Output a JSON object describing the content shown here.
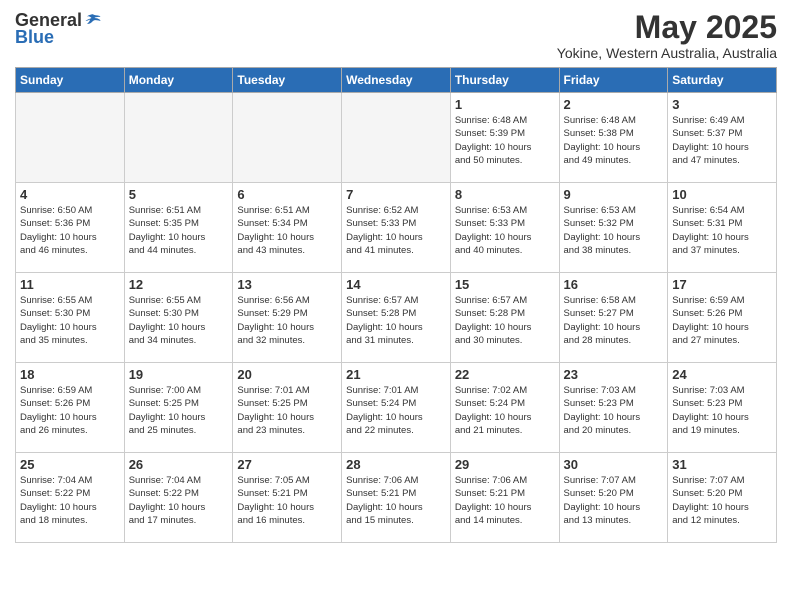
{
  "header": {
    "logo_general": "General",
    "logo_blue": "Blue",
    "month_title": "May 2025",
    "location": "Yokine, Western Australia, Australia"
  },
  "weekdays": [
    "Sunday",
    "Monday",
    "Tuesday",
    "Wednesday",
    "Thursday",
    "Friday",
    "Saturday"
  ],
  "weeks": [
    [
      {
        "day": "",
        "info": ""
      },
      {
        "day": "",
        "info": ""
      },
      {
        "day": "",
        "info": ""
      },
      {
        "day": "",
        "info": ""
      },
      {
        "day": "1",
        "info": "Sunrise: 6:48 AM\nSunset: 5:39 PM\nDaylight: 10 hours\nand 50 minutes."
      },
      {
        "day": "2",
        "info": "Sunrise: 6:48 AM\nSunset: 5:38 PM\nDaylight: 10 hours\nand 49 minutes."
      },
      {
        "day": "3",
        "info": "Sunrise: 6:49 AM\nSunset: 5:37 PM\nDaylight: 10 hours\nand 47 minutes."
      }
    ],
    [
      {
        "day": "4",
        "info": "Sunrise: 6:50 AM\nSunset: 5:36 PM\nDaylight: 10 hours\nand 46 minutes."
      },
      {
        "day": "5",
        "info": "Sunrise: 6:51 AM\nSunset: 5:35 PM\nDaylight: 10 hours\nand 44 minutes."
      },
      {
        "day": "6",
        "info": "Sunrise: 6:51 AM\nSunset: 5:34 PM\nDaylight: 10 hours\nand 43 minutes."
      },
      {
        "day": "7",
        "info": "Sunrise: 6:52 AM\nSunset: 5:33 PM\nDaylight: 10 hours\nand 41 minutes."
      },
      {
        "day": "8",
        "info": "Sunrise: 6:53 AM\nSunset: 5:33 PM\nDaylight: 10 hours\nand 40 minutes."
      },
      {
        "day": "9",
        "info": "Sunrise: 6:53 AM\nSunset: 5:32 PM\nDaylight: 10 hours\nand 38 minutes."
      },
      {
        "day": "10",
        "info": "Sunrise: 6:54 AM\nSunset: 5:31 PM\nDaylight: 10 hours\nand 37 minutes."
      }
    ],
    [
      {
        "day": "11",
        "info": "Sunrise: 6:55 AM\nSunset: 5:30 PM\nDaylight: 10 hours\nand 35 minutes."
      },
      {
        "day": "12",
        "info": "Sunrise: 6:55 AM\nSunset: 5:30 PM\nDaylight: 10 hours\nand 34 minutes."
      },
      {
        "day": "13",
        "info": "Sunrise: 6:56 AM\nSunset: 5:29 PM\nDaylight: 10 hours\nand 32 minutes."
      },
      {
        "day": "14",
        "info": "Sunrise: 6:57 AM\nSunset: 5:28 PM\nDaylight: 10 hours\nand 31 minutes."
      },
      {
        "day": "15",
        "info": "Sunrise: 6:57 AM\nSunset: 5:28 PM\nDaylight: 10 hours\nand 30 minutes."
      },
      {
        "day": "16",
        "info": "Sunrise: 6:58 AM\nSunset: 5:27 PM\nDaylight: 10 hours\nand 28 minutes."
      },
      {
        "day": "17",
        "info": "Sunrise: 6:59 AM\nSunset: 5:26 PM\nDaylight: 10 hours\nand 27 minutes."
      }
    ],
    [
      {
        "day": "18",
        "info": "Sunrise: 6:59 AM\nSunset: 5:26 PM\nDaylight: 10 hours\nand 26 minutes."
      },
      {
        "day": "19",
        "info": "Sunrise: 7:00 AM\nSunset: 5:25 PM\nDaylight: 10 hours\nand 25 minutes."
      },
      {
        "day": "20",
        "info": "Sunrise: 7:01 AM\nSunset: 5:25 PM\nDaylight: 10 hours\nand 23 minutes."
      },
      {
        "day": "21",
        "info": "Sunrise: 7:01 AM\nSunset: 5:24 PM\nDaylight: 10 hours\nand 22 minutes."
      },
      {
        "day": "22",
        "info": "Sunrise: 7:02 AM\nSunset: 5:24 PM\nDaylight: 10 hours\nand 21 minutes."
      },
      {
        "day": "23",
        "info": "Sunrise: 7:03 AM\nSunset: 5:23 PM\nDaylight: 10 hours\nand 20 minutes."
      },
      {
        "day": "24",
        "info": "Sunrise: 7:03 AM\nSunset: 5:23 PM\nDaylight: 10 hours\nand 19 minutes."
      }
    ],
    [
      {
        "day": "25",
        "info": "Sunrise: 7:04 AM\nSunset: 5:22 PM\nDaylight: 10 hours\nand 18 minutes."
      },
      {
        "day": "26",
        "info": "Sunrise: 7:04 AM\nSunset: 5:22 PM\nDaylight: 10 hours\nand 17 minutes."
      },
      {
        "day": "27",
        "info": "Sunrise: 7:05 AM\nSunset: 5:21 PM\nDaylight: 10 hours\nand 16 minutes."
      },
      {
        "day": "28",
        "info": "Sunrise: 7:06 AM\nSunset: 5:21 PM\nDaylight: 10 hours\nand 15 minutes."
      },
      {
        "day": "29",
        "info": "Sunrise: 7:06 AM\nSunset: 5:21 PM\nDaylight: 10 hours\nand 14 minutes."
      },
      {
        "day": "30",
        "info": "Sunrise: 7:07 AM\nSunset: 5:20 PM\nDaylight: 10 hours\nand 13 minutes."
      },
      {
        "day": "31",
        "info": "Sunrise: 7:07 AM\nSunset: 5:20 PM\nDaylight: 10 hours\nand 12 minutes."
      }
    ]
  ]
}
